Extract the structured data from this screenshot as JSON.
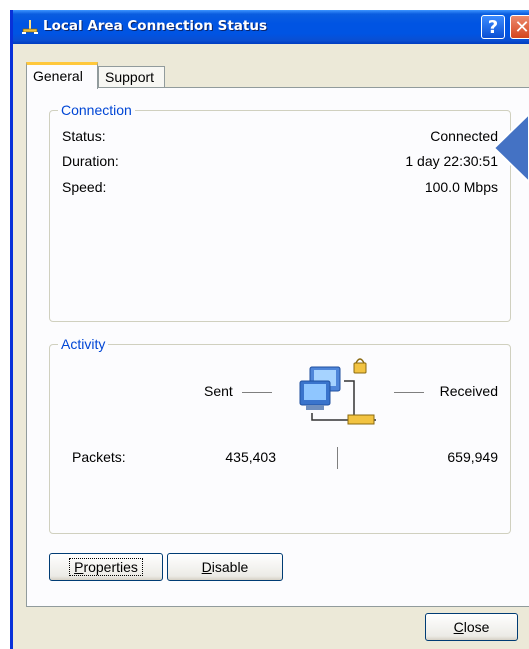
{
  "window": {
    "title": "Local Area Connection Status"
  },
  "title_buttons": {
    "help": "?",
    "close": "✕"
  },
  "tabs": [
    {
      "label": "General",
      "active": true
    },
    {
      "label": "Support",
      "active": false
    }
  ],
  "connection": {
    "title": "Connection",
    "rows": [
      {
        "label": "Status:",
        "value": "Connected"
      },
      {
        "label": "Duration:",
        "value": "1 day 22:30:51"
      },
      {
        "label": "Speed:",
        "value": "100.0 Mbps"
      }
    ]
  },
  "activity": {
    "title": "Activity",
    "sent_label": "Sent",
    "received_label": "Received",
    "packets_label": "Packets:",
    "packets_sent": "435,403",
    "packets_received": "659,949"
  },
  "buttons": {
    "properties": {
      "mnemonic": "P",
      "rest": "roperties"
    },
    "disable": {
      "mnemonic": "D",
      "rest": "isable"
    },
    "close": {
      "mnemonic": "C",
      "rest": "lose"
    }
  },
  "colors": {
    "titlebar": "#0054e3",
    "group_title": "#0046d5",
    "tab_highlight": "#ffc83c",
    "callout": "#4472c4"
  },
  "icons": [
    "network-connection-icon",
    "help-icon",
    "close-icon",
    "network-activity-icon",
    "callout-arrow-icon"
  ]
}
